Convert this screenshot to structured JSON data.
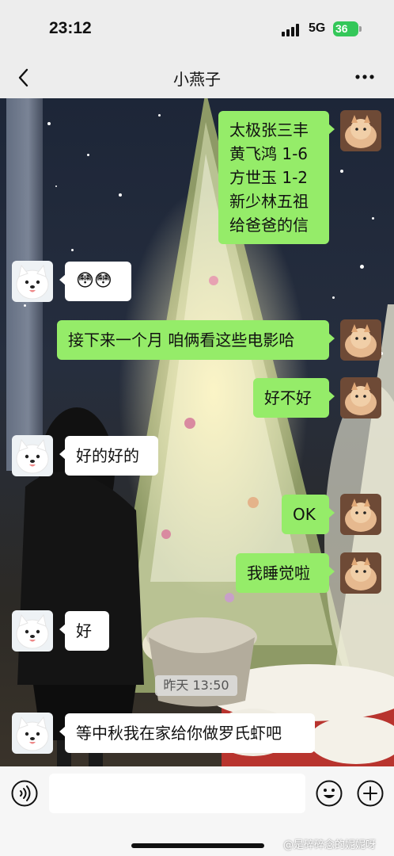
{
  "status_bar": {
    "time": "23:12",
    "network": "5G",
    "battery": "36"
  },
  "nav": {
    "title": "小燕子"
  },
  "messages": [
    {
      "side": "right",
      "lines": [
        "太极张三丰",
        "黄飞鸿 1-6",
        "方世玉 1-2",
        "新少林五祖",
        "给爸爸的信"
      ]
    },
    {
      "side": "left",
      "lines": [
        "😳😳"
      ]
    },
    {
      "side": "right",
      "lines": [
        "接下来一个月 咱俩看这些电影哈"
      ]
    },
    {
      "side": "right",
      "lines": [
        "好不好"
      ]
    },
    {
      "side": "left",
      "lines": [
        "好的好的"
      ]
    },
    {
      "side": "right",
      "lines": [
        "OK"
      ]
    },
    {
      "side": "right",
      "lines": [
        "我睡觉啦"
      ]
    },
    {
      "side": "left",
      "lines": [
        "好"
      ]
    },
    {
      "side": "left",
      "lines": [
        "等中秋我在家给你做罗氏虾吧"
      ]
    }
  ],
  "timestamp": "昨天 13:50",
  "input": {
    "value": ""
  },
  "watermark": "@是碎碎念的妮妮呀",
  "colors": {
    "bubble_self": "#95ec69",
    "bubble_other": "#ffffff",
    "background": "#ededed",
    "battery": "#34c759"
  },
  "icons": {
    "back": "chevron-left-icon",
    "more": "more-icon",
    "voice": "voice-icon",
    "emoji": "emoji-icon",
    "plus": "plus-icon",
    "avatar_self": "kitten-avatar",
    "avatar_other": "samoyed-avatar"
  }
}
